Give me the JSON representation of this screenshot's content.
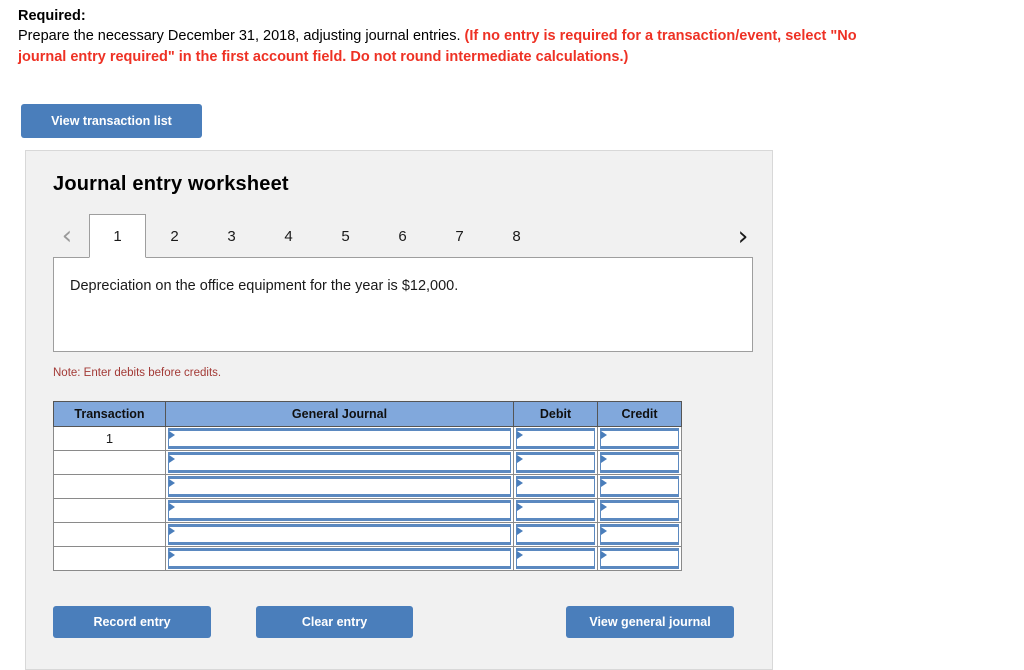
{
  "prompt": {
    "required_label": "Required:",
    "line1_black": "Prepare the necessary December 31, 2018, adjusting journal entries.",
    "line1_red": "(If no entry is required for a transaction/event, select \"No",
    "line2_red": "journal entry required\" in the first account field. Do not round intermediate calculations.)"
  },
  "toolbar": {
    "view_transaction_list": "View transaction list"
  },
  "worksheet": {
    "title": "Journal entry worksheet",
    "prev_icon": "chevron-left-icon",
    "next_icon": "chevron-right-icon",
    "prev_glyph": "‹",
    "next_glyph": "›",
    "tabs": [
      {
        "label": "1",
        "active": true
      },
      {
        "label": "2",
        "active": false
      },
      {
        "label": "3",
        "active": false
      },
      {
        "label": "4",
        "active": false
      },
      {
        "label": "5",
        "active": false
      },
      {
        "label": "6",
        "active": false
      },
      {
        "label": "7",
        "active": false
      },
      {
        "label": "8",
        "active": false
      }
    ],
    "description": "Depreciation on the office equipment for the year is $12,000.",
    "note": "Note: Enter debits before credits."
  },
  "journal_table": {
    "headers": [
      "Transaction",
      "General Journal",
      "Debit",
      "Credit"
    ],
    "rows": [
      {
        "transaction": "1",
        "general_journal": "",
        "debit": "",
        "credit": ""
      },
      {
        "transaction": "",
        "general_journal": "",
        "debit": "",
        "credit": ""
      },
      {
        "transaction": "",
        "general_journal": "",
        "debit": "",
        "credit": ""
      },
      {
        "transaction": "",
        "general_journal": "",
        "debit": "",
        "credit": ""
      },
      {
        "transaction": "",
        "general_journal": "",
        "debit": "",
        "credit": ""
      },
      {
        "transaction": "",
        "general_journal": "",
        "debit": "",
        "credit": ""
      }
    ]
  },
  "actions": {
    "record_entry": "Record entry",
    "clear_entry": "Clear entry",
    "view_general_journal": "View general journal"
  },
  "colors": {
    "accent_blue": "#4a7ebb",
    "header_blue": "#81a8dc",
    "alert_red": "#ee3124",
    "note_red": "#a33a36",
    "panel_bg": "#f1f1f1"
  }
}
